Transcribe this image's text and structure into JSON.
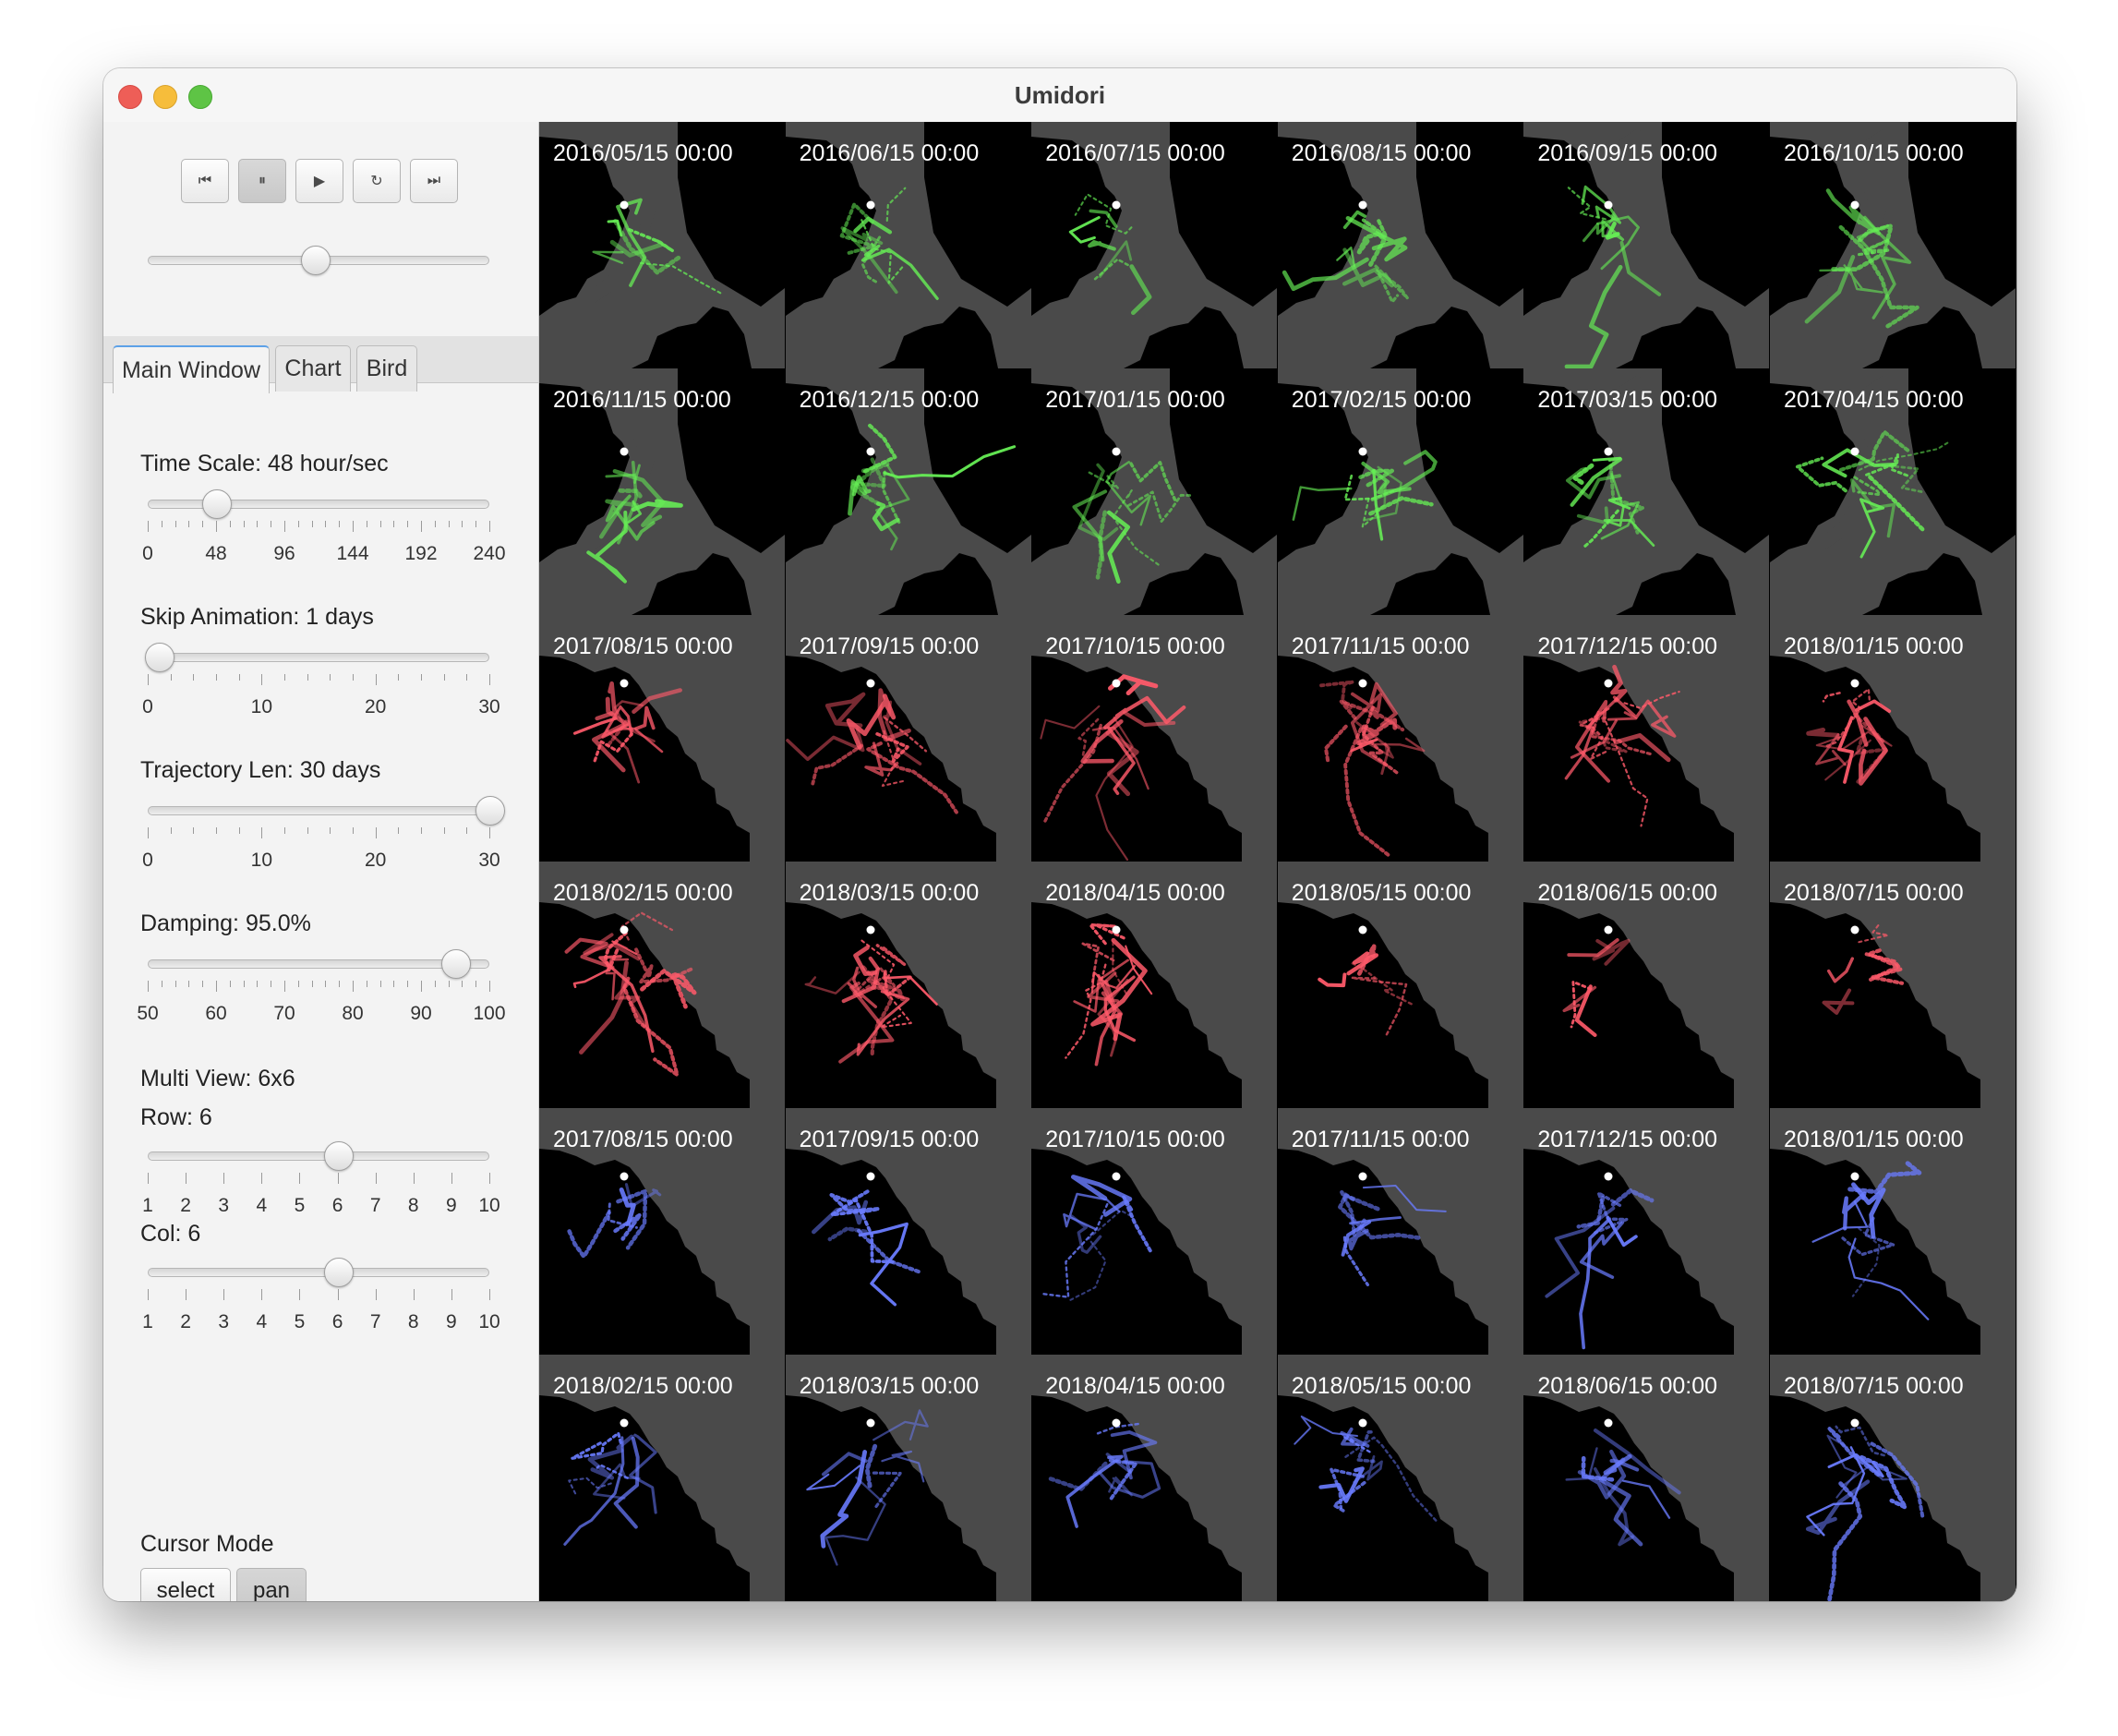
{
  "window": {
    "title": "Umidori"
  },
  "media_controls": {
    "buttons": [
      {
        "name": "skip-to-start",
        "glyph": "⏮",
        "active": false
      },
      {
        "name": "pause",
        "glyph": "⏸",
        "active": true
      },
      {
        "name": "play",
        "glyph": "▶",
        "active": false
      },
      {
        "name": "repeat",
        "glyph": "↻",
        "active": false
      },
      {
        "name": "skip-to-end",
        "glyph": "⏭",
        "active": false
      }
    ],
    "playback_position": 0.49
  },
  "tabs": [
    {
      "label": "Main Window",
      "selected": true
    },
    {
      "label": "Chart",
      "selected": false
    },
    {
      "label": "Bird",
      "selected": false
    }
  ],
  "settings": {
    "time_scale": {
      "label": "Time Scale: 48 hour/sec",
      "value": 48,
      "min": 0,
      "max": 240,
      "ticks": [
        "0",
        "48",
        "96",
        "144",
        "192",
        "240"
      ]
    },
    "skip_animation": {
      "label": "Skip Animation: 1 days",
      "value": 1,
      "min": 0,
      "max": 30,
      "ticks": [
        "0",
        "10",
        "20",
        "30"
      ]
    },
    "trajectory_len": {
      "label": "Trajectory Len: 30 days",
      "value": 30,
      "min": 0,
      "max": 30,
      "ticks": [
        "0",
        "10",
        "20",
        "30"
      ]
    },
    "damping": {
      "label": "Damping: 95.0%",
      "value": 95,
      "min": 50,
      "max": 100,
      "ticks": [
        "50",
        "60",
        "70",
        "80",
        "90",
        "100"
      ]
    },
    "multi_view": {
      "label": "Multi View: 6x6"
    },
    "row": {
      "label": "Row: 6",
      "value": 6,
      "min": 1,
      "max": 10,
      "ticks": [
        "1",
        "2",
        "3",
        "4",
        "5",
        "6",
        "7",
        "8",
        "9",
        "10"
      ]
    },
    "col": {
      "label": "Col: 6",
      "value": 6,
      "min": 1,
      "max": 10,
      "ticks": [
        "1",
        "2",
        "3",
        "4",
        "5",
        "6",
        "7",
        "8",
        "9",
        "10"
      ]
    }
  },
  "cursor_mode": {
    "label": "Cursor Mode",
    "buttons": [
      {
        "label": "select",
        "active": false
      },
      {
        "label": "pan",
        "active": true
      }
    ]
  },
  "colors": {
    "green_tracks": "#66ee55",
    "red_tracks": "#ff5a6a",
    "blue_tracks": "#6a7cff",
    "land": "#4a4a4a",
    "sea": "#000000"
  },
  "panels": [
    "2016/05/15 00:00",
    "2016/06/15 00:00",
    "2016/07/15 00:00",
    "2016/08/15 00:00",
    "2016/09/15 00:00",
    "2016/10/15 00:00",
    "2016/11/15 00:00",
    "2016/12/15 00:00",
    "2017/01/15 00:00",
    "2017/02/15 00:00",
    "2017/03/15 00:00",
    "2017/04/15 00:00",
    "2017/08/15 00:00",
    "2017/09/15 00:00",
    "2017/10/15 00:00",
    "2017/11/15 00:00",
    "2017/12/15 00:00",
    "2018/01/15 00:00",
    "2018/02/15 00:00",
    "2018/03/15 00:00",
    "2018/04/15 00:00",
    "2018/05/15 00:00",
    "2018/06/15 00:00",
    "2018/07/15 00:00",
    "2017/08/15 00:00",
    "2017/09/15 00:00",
    "2017/10/15 00:00",
    "2017/11/15 00:00",
    "2017/12/15 00:00",
    "2018/01/15 00:00",
    "2018/02/15 00:00",
    "2018/03/15 00:00",
    "2018/04/15 00:00",
    "2018/05/15 00:00",
    "2018/06/15 00:00",
    "2018/07/15 00:00"
  ]
}
